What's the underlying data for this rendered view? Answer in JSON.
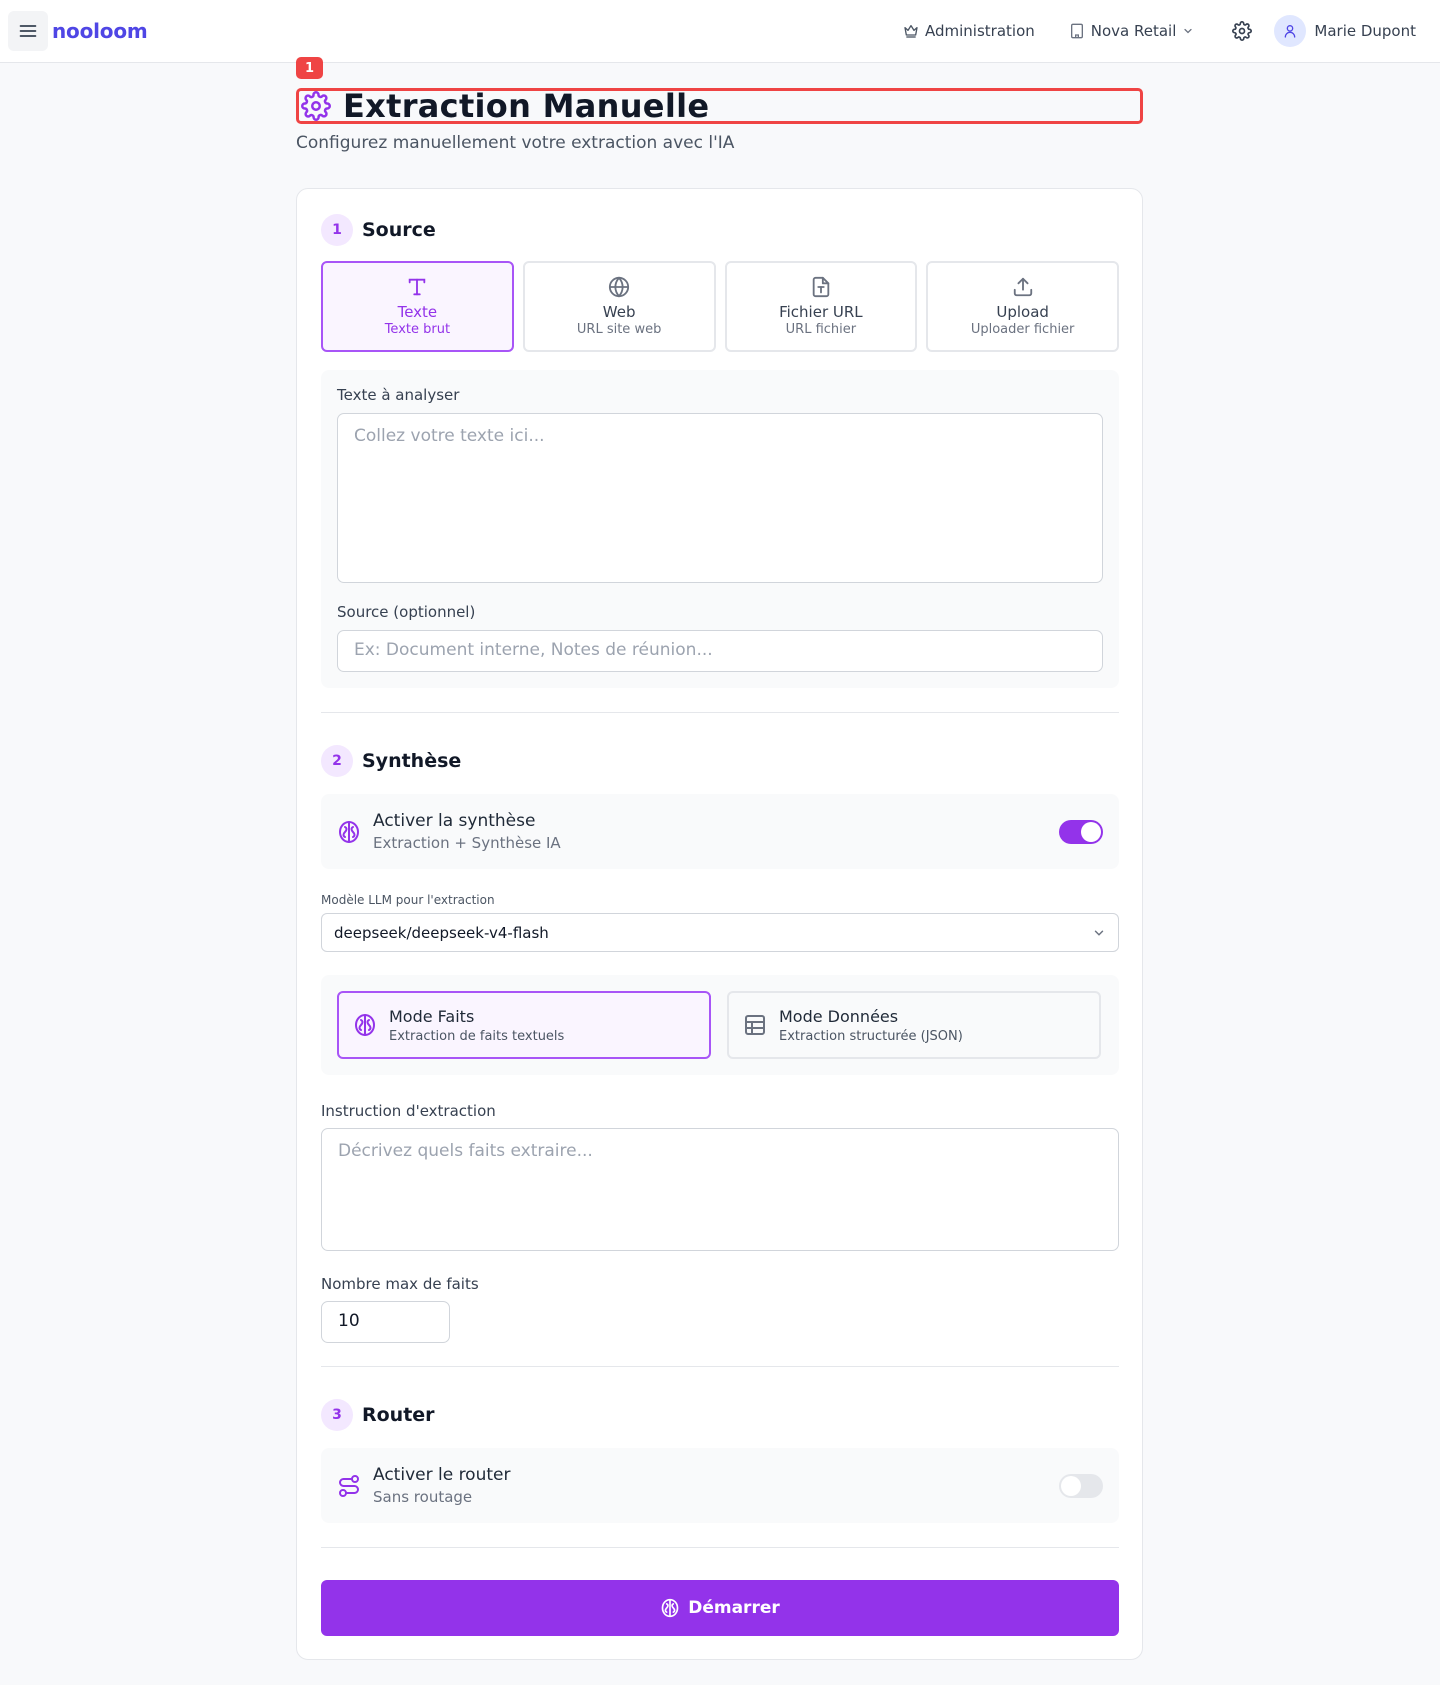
{
  "topbar": {
    "brand": "nooloom",
    "admin_label": "Administration",
    "org_label": "Nova Retail",
    "user_name": "Marie Dupont"
  },
  "page": {
    "badge": "1",
    "title": "Extraction Manuelle",
    "subtitle": "Configurez manuellement votre extraction avec l'IA"
  },
  "source": {
    "step": "1",
    "title": "Source",
    "types": [
      {
        "label": "Texte",
        "sub": "Texte brut",
        "icon": "text-icon",
        "active": true
      },
      {
        "label": "Web",
        "sub": "URL site web",
        "icon": "globe-icon",
        "active": false
      },
      {
        "label": "Fichier URL",
        "sub": "URL fichier",
        "icon": "file-text-icon",
        "active": false
      },
      {
        "label": "Upload",
        "sub": "Uploader fichier",
        "icon": "upload-icon",
        "active": false
      }
    ],
    "text_label": "Texte à analyser",
    "text_placeholder": "Collez votre texte ici...",
    "source_label": "Source (optionnel)",
    "source_placeholder": "Ex: Document interne, Notes de réunion..."
  },
  "synthese": {
    "step": "2",
    "title": "Synthèse",
    "toggle_title": "Activer la synthèse",
    "toggle_sub": "Extraction + Synthèse IA",
    "toggle_on": true,
    "model_label": "Modèle LLM pour l'extraction",
    "model_value": "deepseek/deepseek-v4-flash",
    "modes": [
      {
        "title": "Mode Faits",
        "sub": "Extraction de faits textuels",
        "icon": "brain-icon",
        "active": true
      },
      {
        "title": "Mode Données",
        "sub": "Extraction structurée (JSON)",
        "icon": "table-icon",
        "active": false
      }
    ],
    "instruction_label": "Instruction d'extraction",
    "instruction_placeholder": "Décrivez quels faits extraire...",
    "max_label": "Nombre max de faits",
    "max_value": "10"
  },
  "router": {
    "step": "3",
    "title": "Router",
    "toggle_title": "Activer le router",
    "toggle_sub": "Sans routage",
    "toggle_on": false
  },
  "actions": {
    "start_label": "Démarrer"
  },
  "colors": {
    "accent": "#9333ea",
    "brand": "#4f46e5",
    "highlight": "#ef4444"
  }
}
